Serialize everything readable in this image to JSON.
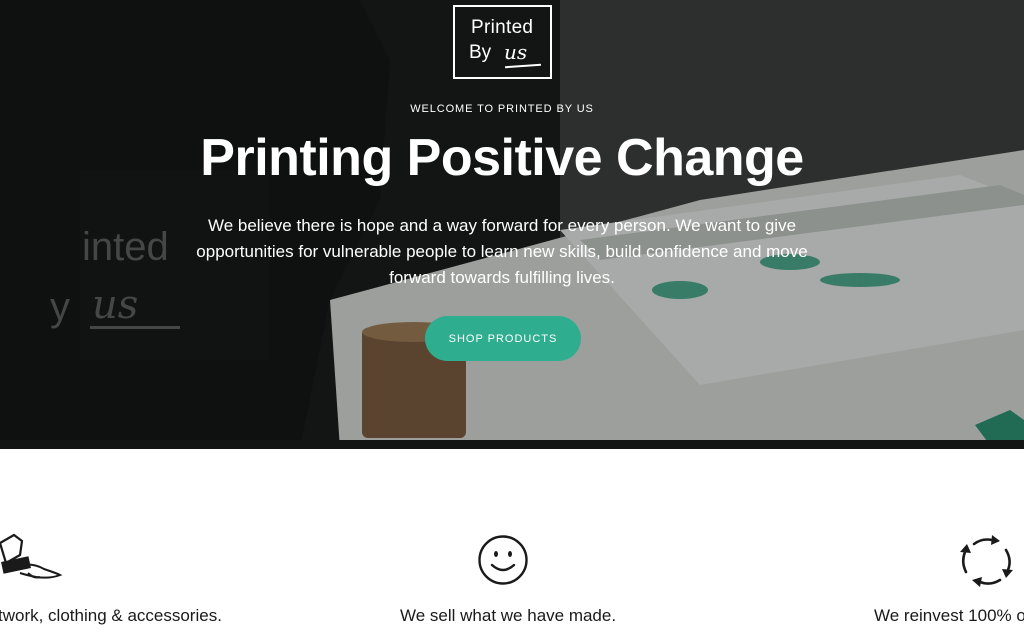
{
  "logo": {
    "line1": "Printed",
    "line2": "By",
    "script": "us"
  },
  "hero": {
    "eyebrow": "WELCOME TO PRINTED BY US",
    "headline": "Printing Positive Change",
    "lede": "We believe there is hope and a way forward for every person. We want to give opportunities for vulnerable people to learn new skills, build confidence and move forward towards fulfilling lives.",
    "cta_label": "SHOP PRODUCTS"
  },
  "features": [
    {
      "icon": "print-roller-icon",
      "text": "twork, clothing & accessories."
    },
    {
      "icon": "smiley-face-icon",
      "text": "We sell what we have made."
    },
    {
      "icon": "cycle-arrows-icon",
      "text": "We reinvest 100% of"
    }
  ],
  "colors": {
    "accent": "#2fae8f",
    "hero_dark": "#1b1e1c",
    "text": "#1a1a1a"
  }
}
